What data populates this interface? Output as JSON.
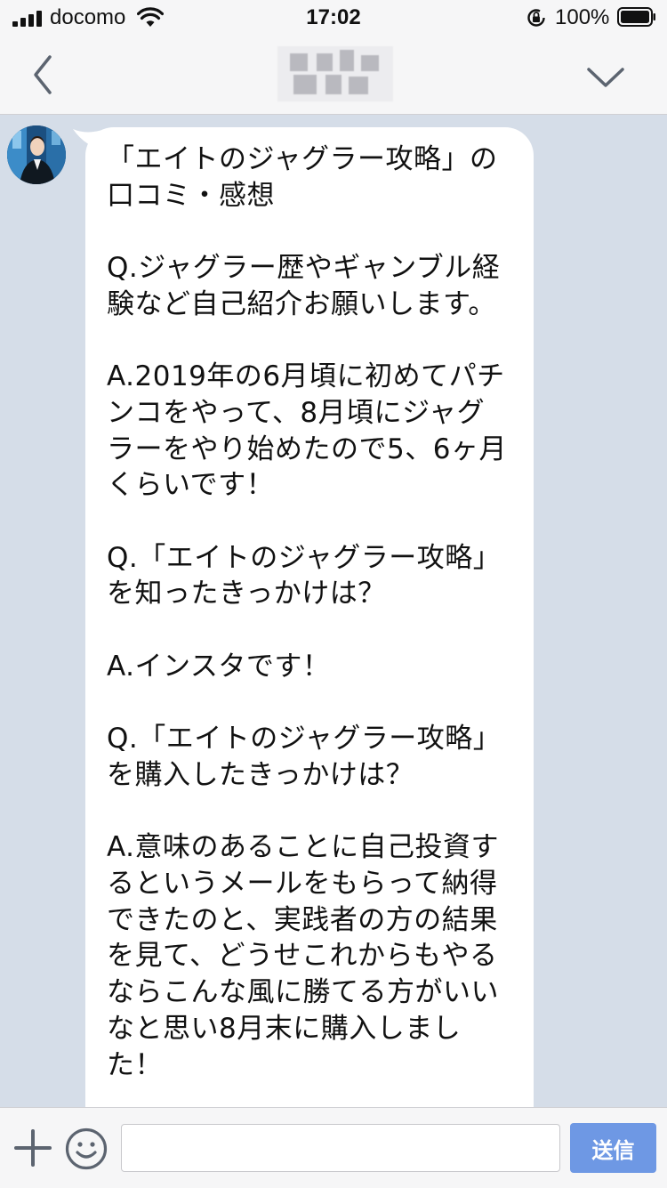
{
  "status_bar": {
    "carrier": "docomo",
    "time": "17:02",
    "battery": "100%"
  },
  "header": {
    "back_icon": "chevron-left-icon",
    "title_obscured": true,
    "dropdown_icon": "chevron-down-icon"
  },
  "chat": {
    "messages": [
      {
        "sender": "other",
        "text": "「エイトのジャグラー攻略」の\n口コミ・感想\n\nQ.ジャグラー歴やギャンブル経\n験など自己紹介お願いします。\n\nA.2019年の6月頃に初めてパチ\nンコをやって、8月頃にジャグ\nラーをやり始めたので5、6ヶ月\nくらいです！\n\nQ.「エイトのジャグラー攻略」\nを知ったきっかけは？\n\nA.インスタです！\n\nQ.「エイトのジャグラー攻略」\nを購入したきっかけは？\n\nA.意味のあることに自己投資す\nるというメールをもらって納得\nできたのと、実践者の方の結果\nを見て、どうせこれからもやる\nならこんな風に勝てる方がいい\nなと思い8月末に購入しまし\nた！\n\nQ.「エイトのジャグラー攻略"
      }
    ]
  },
  "input_bar": {
    "plus_icon": "plus-icon",
    "emoji_icon": "smiley-icon",
    "placeholder": "",
    "send_label": "送信"
  },
  "colors": {
    "chat_background": "#d5dde8",
    "bar_background": "#f6f6f7",
    "bubble": "#ffffff",
    "send_button": "#6e98e4",
    "icon_gray": "#5c6470"
  }
}
